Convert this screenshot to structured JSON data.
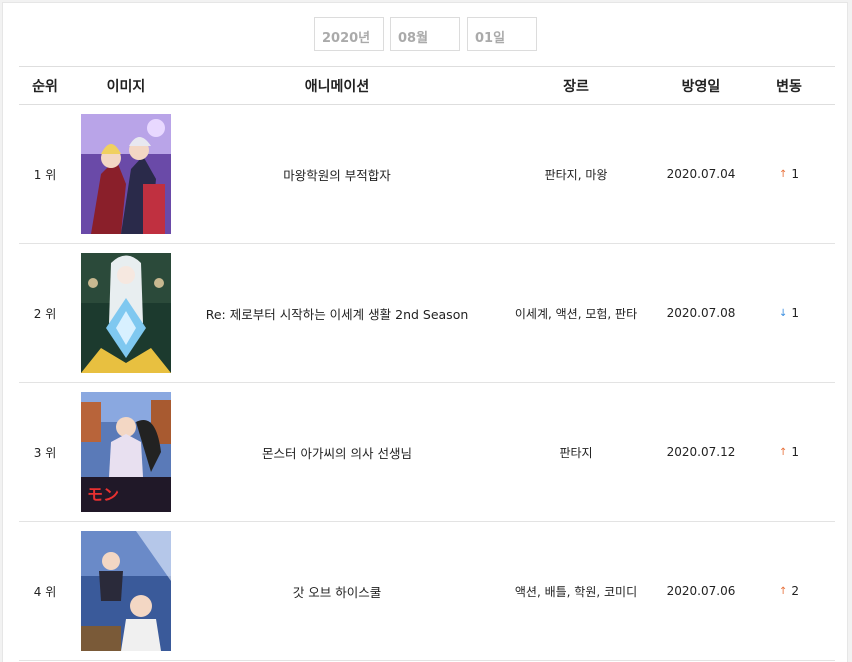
{
  "date": {
    "year": "2020년",
    "month": "08월",
    "day": "01일"
  },
  "headers": {
    "rank": "순위",
    "image": "이미지",
    "title": "애니메이션",
    "genre": "장르",
    "air_date": "방영일",
    "change": "변동"
  },
  "rows": [
    {
      "rank": "1 위",
      "title": "마왕학원의 부적합자",
      "genre": "판타지, 마왕",
      "air_date": "2020.07.04",
      "direction": "up",
      "change": "1",
      "poster_icon": "poster-image"
    },
    {
      "rank": "2 위",
      "title": "Re: 제로부터 시작하는 이세계 생활 2nd Season",
      "genre": "이세계, 액션, 모험, 판타",
      "air_date": "2020.07.08",
      "direction": "down",
      "change": "1",
      "poster_icon": "poster-image"
    },
    {
      "rank": "3 위",
      "title": "몬스터 아가씨의 의사 선생님",
      "genre": "판타지",
      "air_date": "2020.07.12",
      "direction": "up",
      "change": "1",
      "poster_icon": "poster-image"
    },
    {
      "rank": "4 위",
      "title": "갓 오브 하이스쿨",
      "genre": "액션, 배틀, 학원, 코미디",
      "air_date": "2020.07.06",
      "direction": "up",
      "change": "2",
      "poster_icon": "poster-image"
    }
  ],
  "arrow_colors": {
    "up": "#e8703a",
    "down": "#3a8ee0"
  }
}
